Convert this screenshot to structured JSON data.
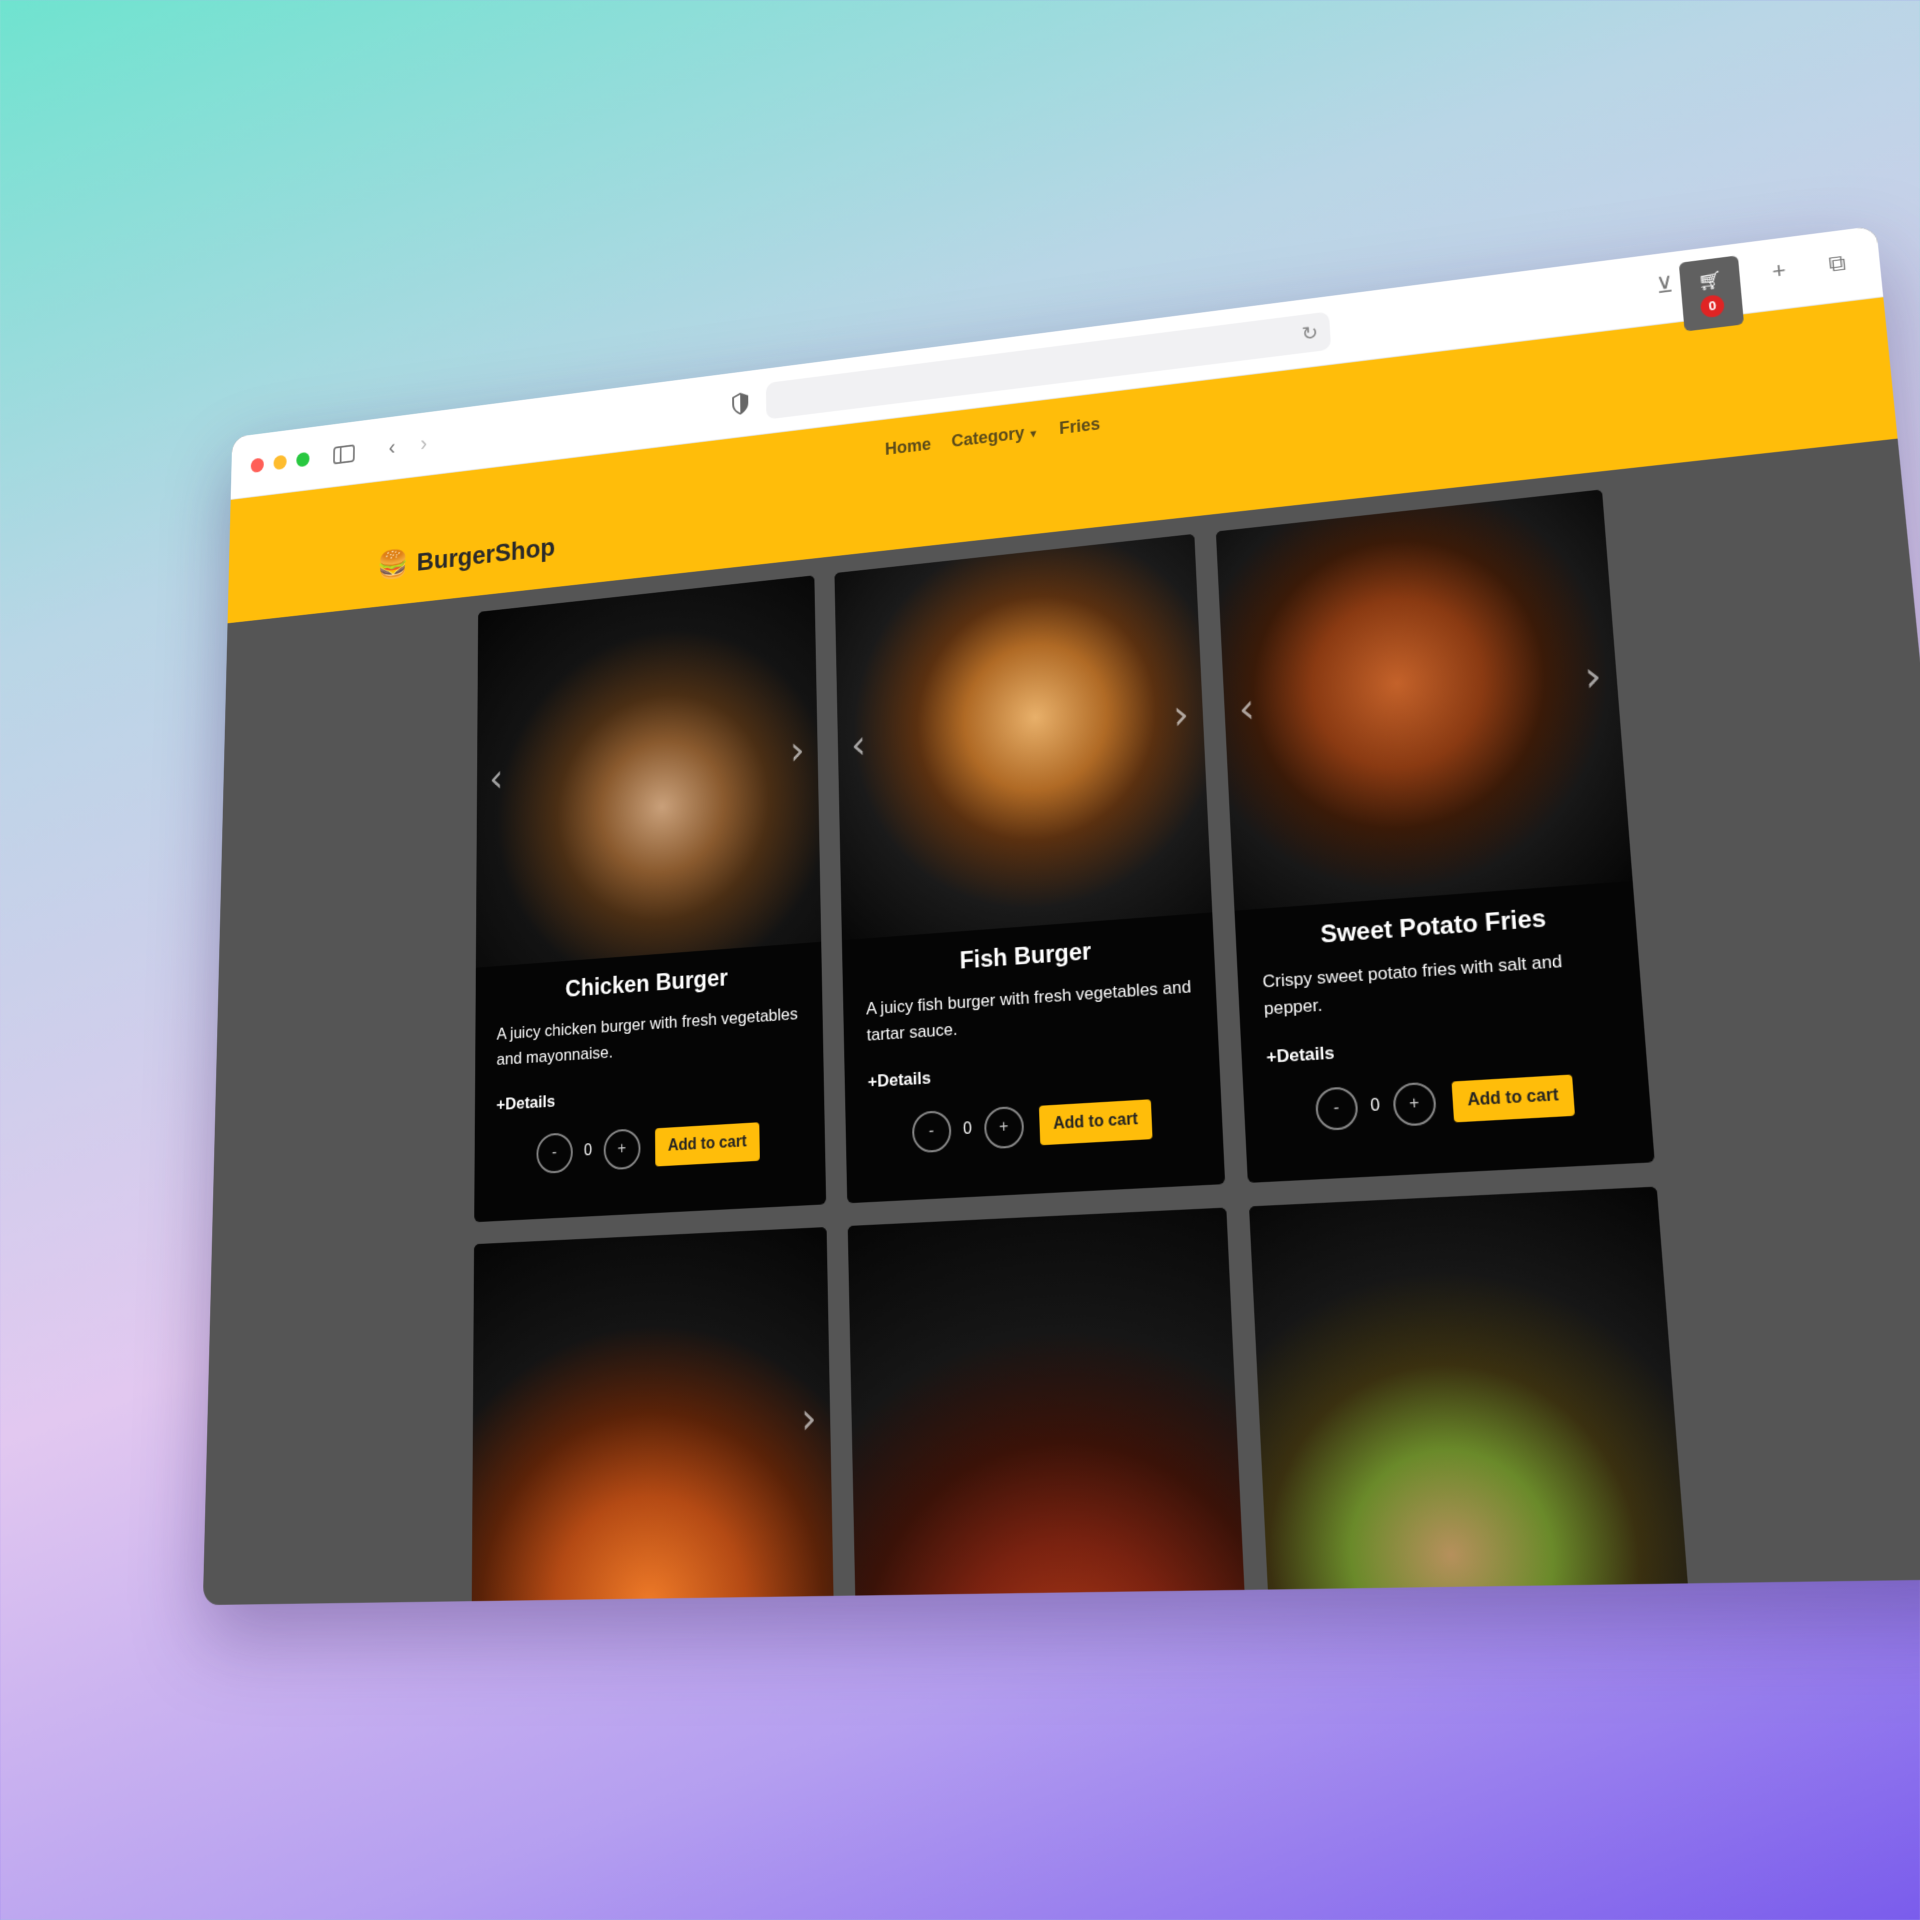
{
  "browser": {
    "icons": [
      "sidebar-icon",
      "back-icon",
      "forward-icon",
      "shield-icon",
      "reload-icon",
      "download-icon",
      "share-icon",
      "new-tab-icon",
      "tabs-icon"
    ]
  },
  "site": {
    "brand": "BurgerShop",
    "brand_color": "#ffbd0a",
    "nav": {
      "home": "Home",
      "category": "Category",
      "fries": "Fries"
    },
    "cart_count": "0"
  },
  "products": [
    {
      "title": "Chicken Burger",
      "desc": "A juicy chicken burger with fresh vegetables and mayonnaise.",
      "details": "+Details",
      "qty": "0",
      "minus": "-",
      "plus": "+",
      "add": "Add to cart"
    },
    {
      "title": "Fish Burger",
      "desc": "A juicy fish burger with fresh vegetables and tartar sauce.",
      "details": "+Details",
      "qty": "0",
      "minus": "-",
      "plus": "+",
      "add": "Add to cart"
    },
    {
      "title": "Sweet Potato Fries",
      "desc": "Crispy sweet potato fries with salt and pepper.",
      "details": "+Details",
      "qty": "0",
      "minus": "-",
      "plus": "+",
      "add": "Add to cart"
    }
  ]
}
